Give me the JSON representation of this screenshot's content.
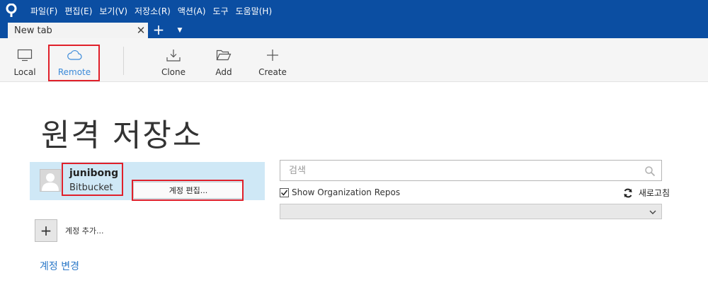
{
  "menubar": {
    "logo_icon": "sourcetree-logo-icon",
    "items": [
      "파일(F)",
      "편집(E)",
      "보기(V)",
      "저장소(R)",
      "액션(A)",
      "도구",
      "도움말(H)"
    ]
  },
  "tabs": {
    "active_label": "New tab",
    "close_glyph": "✕",
    "add_glyph": "+",
    "dropdown_glyph": "▼"
  },
  "toolbar": {
    "local_label": "Local",
    "remote_label": "Remote",
    "clone_label": "Clone",
    "add_label": "Add",
    "create_label": "Create",
    "active": "Remote"
  },
  "page": {
    "title": "원격 저장소"
  },
  "account": {
    "name": "junibong",
    "host": "Bitbucket",
    "edit_button": "계정 편집...",
    "add_button_glyph": "+",
    "add_label": "계정 추가...",
    "change_link": "계정 변경"
  },
  "repos": {
    "search_placeholder": "검색",
    "show_org_label": "Show Organization Repos",
    "show_org_checked": true,
    "refresh_label": "새로고침",
    "filter_selected": ""
  },
  "colors": {
    "menubar_bg": "#0b4ea2",
    "accent": "#3b8ad9",
    "selection_bg": "#cfe8f6",
    "highlight_border": "#e0202a",
    "link": "#2b78c8"
  }
}
